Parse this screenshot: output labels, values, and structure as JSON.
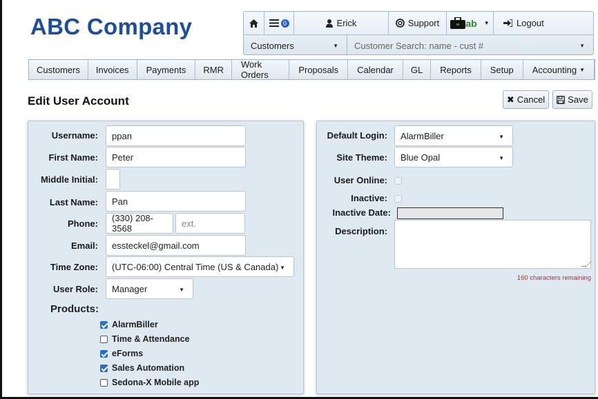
{
  "app": {
    "company": "ABC Company"
  },
  "topbar": {
    "home_icon": "home-icon",
    "messages_icon": "messages-icon",
    "messages_badge": "0",
    "user_name": "Erick",
    "support_label": "Support",
    "brand_badge": "ab",
    "logout_label": "Logout",
    "customers_select": "Customers",
    "search_placeholder": "Customer Search: name - cust #"
  },
  "nav": {
    "items": [
      "Customers",
      "Invoices",
      "Payments",
      "RMR",
      "Work Orders",
      "Proposals",
      "Calendar",
      "GL",
      "Reports",
      "Setup",
      "Accounting"
    ]
  },
  "page": {
    "title": "Edit User Account",
    "cancel_label": "Cancel",
    "save_label": "Save"
  },
  "form_left": {
    "username_label": "Username:",
    "username_value": "ppan",
    "first_name_label": "First Name:",
    "first_name_value": "Peter",
    "middle_initial_label": "Middle Initial:",
    "middle_initial_value": "",
    "last_name_label": "Last Name:",
    "last_name_value": "Pan",
    "phone_label": "Phone:",
    "phone_value": "(330) 208-3568",
    "ext_placeholder": "ext.",
    "email_label": "Email:",
    "email_value": "essteckel@gmail.com",
    "time_zone_label": "Time Zone:",
    "time_zone_value": "(UTC-06:00) Central Time (US & Canada)",
    "user_role_label": "User Role:",
    "user_role_value": "Manager",
    "products_title": "Products:",
    "products": [
      {
        "label": "AlarmBiller",
        "checked": true
      },
      {
        "label": "Time & Attendance",
        "checked": false
      },
      {
        "label": "eForms",
        "checked": true
      },
      {
        "label": "Sales Automation",
        "checked": true
      },
      {
        "label": "Sedona-X Mobile app",
        "checked": false
      }
    ]
  },
  "form_right": {
    "default_login_label": "Default Login:",
    "default_login_value": "AlarmBiller",
    "site_theme_label": "Site Theme:",
    "site_theme_value": "Blue Opal",
    "user_online_label": "User Online:",
    "inactive_label": "Inactive:",
    "inactive_date_label": "Inactive Date:",
    "description_label": "Description:",
    "description_value": "",
    "chars_remaining": "160 characters remaining"
  },
  "colors": {
    "brand": "#1f4e99",
    "panel": "#dfe9f1",
    "checkbox": "#2a6fc9",
    "warning_text": "#c0282d"
  }
}
